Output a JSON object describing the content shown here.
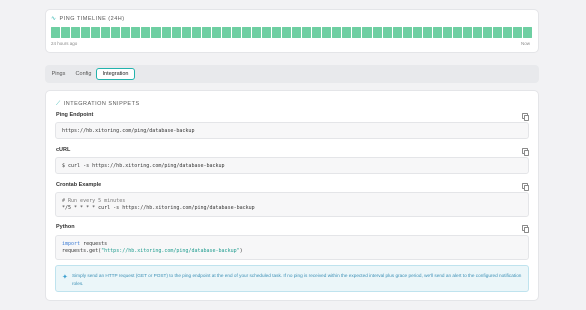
{
  "timeline": {
    "title": "PING TIMELINE (24H)",
    "icon": "activity-icon",
    "start_label": "24 hours ago",
    "end_label": "Now",
    "bar_color": "#6ecfa2",
    "bar_statuses": [
      "up",
      "up",
      "up",
      "up",
      "up",
      "up",
      "up",
      "up",
      "up",
      "up",
      "up",
      "up",
      "up",
      "up",
      "up",
      "up",
      "up",
      "up",
      "up",
      "up",
      "up",
      "up",
      "up",
      "up",
      "up",
      "up",
      "up",
      "up",
      "up",
      "up",
      "up",
      "up",
      "up",
      "up",
      "up",
      "up",
      "up",
      "up",
      "up",
      "up",
      "up",
      "up",
      "up",
      "up",
      "up",
      "up",
      "up",
      "up"
    ]
  },
  "tabs": [
    {
      "label": "Pings",
      "active": false
    },
    {
      "label": "Config",
      "active": false
    },
    {
      "label": "Integration",
      "active": true
    }
  ],
  "accent_color": "#23b3ad",
  "integration": {
    "title": "INTEGRATION SNIPPETS",
    "icon": "code-icon",
    "ping_endpoint": {
      "label": "Ping Endpoint",
      "code": "https://hb.xitoring.com/ping/database-backup"
    },
    "curl": {
      "label": "cURL",
      "code": "$ curl -s https://hb.xitoring.com/ping/database-backup"
    },
    "crontab": {
      "label": "Crontab Example",
      "comment": "# Run every 5 minutes",
      "code": "*/5 * * * * curl -s https://hb.xitoring.com/ping/database-backup"
    },
    "python": {
      "label": "Python",
      "keyword": "import",
      "module": " requests",
      "call_prefix": "requests.get(",
      "call_string": "\"https://hb.xitoring.com/ping/database-backup\"",
      "call_suffix": ")"
    },
    "info": {
      "icon": "lightbulb-icon",
      "text": "Simply send an HTTP request (GET or POST) to the ping endpoint at the end of your scheduled task. If no ping is received within the expected interval plus grace period, we'll send an alert to the configured notification roles."
    }
  }
}
